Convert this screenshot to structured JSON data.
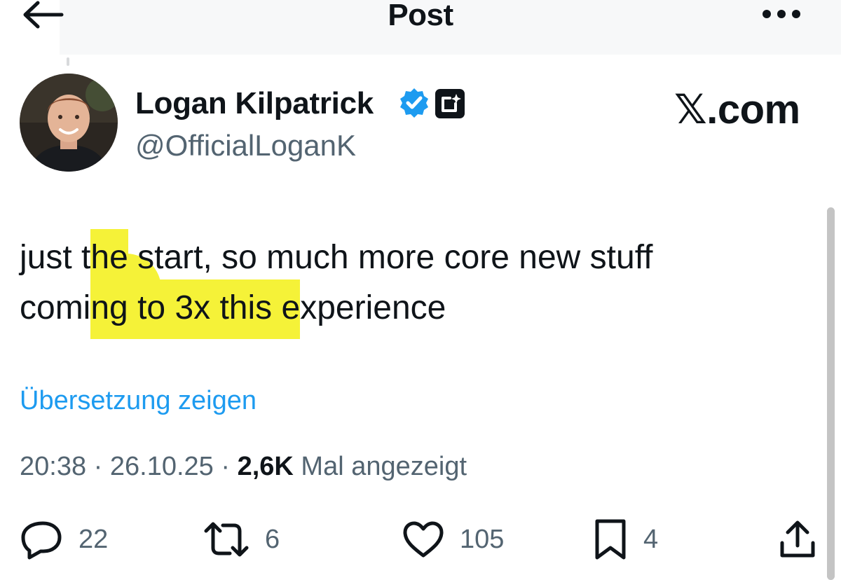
{
  "header": {
    "title": "Post",
    "back_icon": "arrow-left-icon",
    "more_icon": "ellipsis-horizontal-icon"
  },
  "author": {
    "name": "Logan Kilpatrick",
    "handle": "@OfficialLoganK",
    "verified_badge": "verified-badge-icon",
    "affiliate_badge": "affiliate-logo-icon",
    "avatar": "avatar-photo"
  },
  "source": {
    "label": "𝕏.com"
  },
  "post": {
    "line1_a": "just t",
    "line1_hl": "he",
    "line1_b": " start, so much more core new stuff",
    "line2_a": "comi",
    "line2_hl": "ng to 3x this e",
    "line2_b": "xperience",
    "translate": "Übersetzung zeigen"
  },
  "meta": {
    "time": "20:38",
    "separator": "·",
    "date": "26.10.25",
    "views": "2,6K",
    "views_suffix": "Mal angezeigt"
  },
  "actions": {
    "replies": "22",
    "reposts": "6",
    "likes": "105",
    "bookmarks": "4"
  },
  "colors": {
    "accent": "#1d9bf0",
    "text": "#0f1419",
    "secondary": "#536471",
    "highlight": "#f5f238"
  }
}
